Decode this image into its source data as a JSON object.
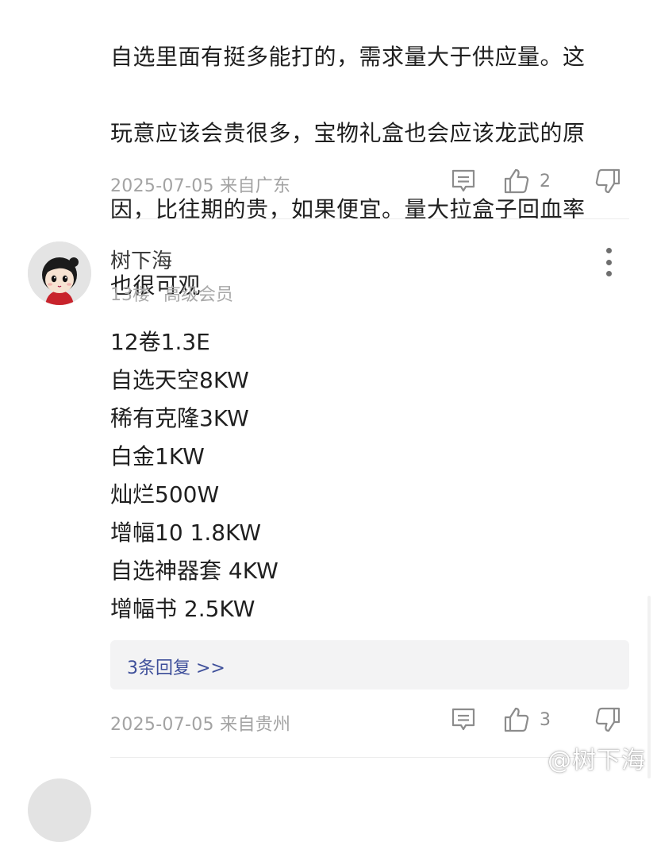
{
  "previous_comment": {
    "text_lines": [
      "自选里面有挺多能打的，需求量大于供应量。这",
      "玩意应该会贵很多，宝物礼盒也会应该龙武的原",
      "因，比往期的贵，如果便宜。量大拉盒子回血率",
      "也很可观"
    ],
    "meta": "2025-07-05 来自广东",
    "like_count": "2"
  },
  "comment": {
    "username": "树下海",
    "floor": "13楼",
    "badge": "高级会员",
    "lines": [
      "12卷1.3E",
      "自选天空8KW",
      "稀有克隆3KW",
      "白金1KW",
      "灿烂500W",
      "增幅10 1.8KW",
      "自选神器套 4KW",
      "增幅书 2.5KW"
    ],
    "replies_label": "3条回复 >>",
    "meta": "2025-07-05 来自贵州",
    "like_count": "3"
  },
  "watermark": "@树下海",
  "colors": {
    "text": "#1f1f1f",
    "meta": "#a3a3a3",
    "link": "#3e4f9a",
    "reply_bg": "#f3f3f4",
    "icon": "#8c8c8c"
  }
}
